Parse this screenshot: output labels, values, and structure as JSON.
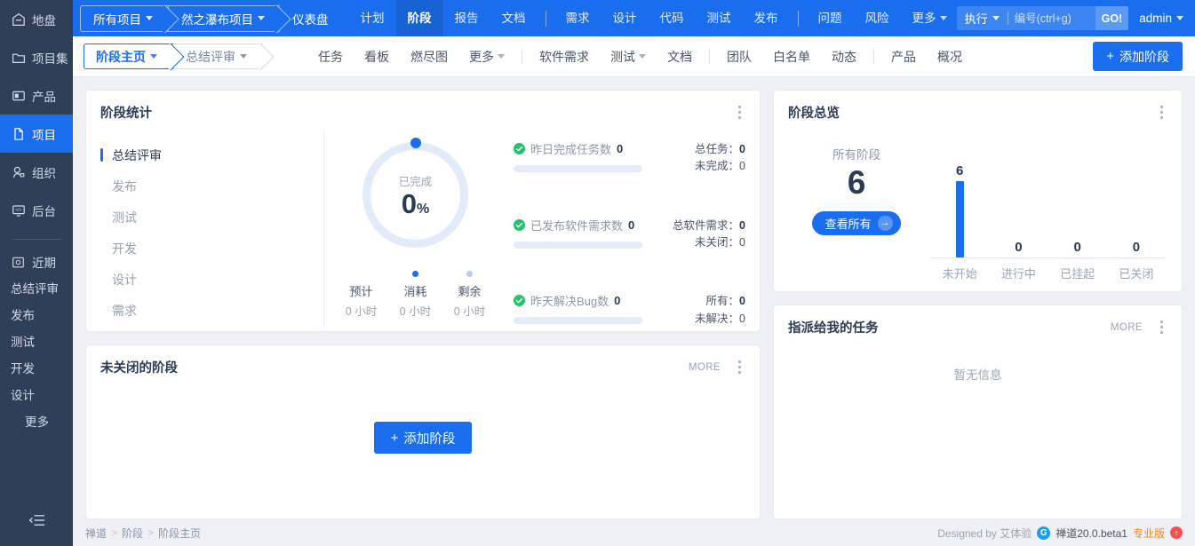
{
  "sidebar": {
    "items": [
      {
        "label": "地盘",
        "icon": "home-icon",
        "active": false
      },
      {
        "label": "项目集",
        "icon": "folder-icon",
        "active": false
      },
      {
        "label": "产品",
        "icon": "box-icon",
        "active": false
      },
      {
        "label": "项目",
        "icon": "file-icon",
        "active": true
      },
      {
        "label": "组织",
        "icon": "user-icon",
        "active": false
      },
      {
        "label": "后台",
        "icon": "monitor-icon",
        "active": false
      }
    ],
    "recent": {
      "label": "近期",
      "icon": "recent-icon"
    },
    "recent_items": [
      "总结评审",
      "发布",
      "测试",
      "开发",
      "设计"
    ],
    "more_label": "更多",
    "collapse_icon": "collapse-icon"
  },
  "topnav": {
    "breadcrumbs": [
      {
        "label": "所有项目",
        "dropdown": true
      },
      {
        "label": "然之瀑布项目",
        "dropdown": true
      },
      {
        "label": "仪表盘",
        "dropdown": false
      }
    ],
    "items_left": [
      {
        "label": "计划",
        "active": false
      },
      {
        "label": "阶段",
        "active": true
      },
      {
        "label": "报告",
        "active": false
      },
      {
        "label": "文档",
        "active": false
      }
    ],
    "items_mid": [
      {
        "label": "需求",
        "active": false
      },
      {
        "label": "设计",
        "active": false
      },
      {
        "label": "代码",
        "active": false
      },
      {
        "label": "测试",
        "active": false
      },
      {
        "label": "发布",
        "active": false
      }
    ],
    "items_right": [
      {
        "label": "问题",
        "active": false
      },
      {
        "label": "风险",
        "active": false
      },
      {
        "label": "更多",
        "active": false,
        "dropdown": true
      }
    ],
    "search": {
      "scope_label": "执行",
      "placeholder": "编号(ctrl+g)",
      "value": "",
      "go_label": "GO!"
    },
    "user": {
      "name": "admin"
    },
    "accent_color": "#1a6eee"
  },
  "subnav": {
    "breadcrumbs": [
      {
        "label": "阶段主页",
        "current": true,
        "dropdown": true
      },
      {
        "label": "总结评审",
        "current": false,
        "dropdown": true
      }
    ],
    "group1": [
      {
        "label": "任务",
        "dropdown": false
      },
      {
        "label": "看板",
        "dropdown": false
      },
      {
        "label": "燃尽图",
        "dropdown": false
      },
      {
        "label": "更多",
        "dropdown": true
      }
    ],
    "group2": [
      {
        "label": "软件需求",
        "dropdown": false
      },
      {
        "label": "测试",
        "dropdown": true
      },
      {
        "label": "文档",
        "dropdown": false
      }
    ],
    "group3": [
      {
        "label": "团队",
        "dropdown": false
      },
      {
        "label": "白名单",
        "dropdown": false
      },
      {
        "label": "动态",
        "dropdown": false
      }
    ],
    "group4": [
      {
        "label": "产品",
        "dropdown": false
      },
      {
        "label": "概况",
        "dropdown": false
      }
    ],
    "add_stage_label": "添加阶段"
  },
  "stage_stats": {
    "title": "阶段统计",
    "stages": [
      {
        "label": "总结评审",
        "selected": true
      },
      {
        "label": "发布",
        "selected": false
      },
      {
        "label": "测试",
        "selected": false
      },
      {
        "label": "开发",
        "selected": false
      },
      {
        "label": "设计",
        "selected": false
      },
      {
        "label": "需求",
        "selected": false
      }
    ],
    "donut": {
      "label": "已完成",
      "value": "0",
      "unit": "%",
      "percent": 0
    },
    "hours": [
      {
        "name": "预计",
        "value": "0 小时",
        "dot": "none"
      },
      {
        "name": "消耗",
        "value": "0 小时",
        "dot": "#1a6eee"
      },
      {
        "name": "剩余",
        "value": "0 小时",
        "dot": "#b5cdf5"
      }
    ],
    "kpis": [
      {
        "label": "昨日完成任务数",
        "count": "0",
        "progress": 0,
        "right": [
          {
            "name": "总任务",
            "value": "0"
          },
          {
            "name": "未完成",
            "value": "0"
          }
        ]
      },
      {
        "label": "已发布软件需求数",
        "count": "0",
        "progress": 0,
        "right": [
          {
            "name": "总软件需求",
            "value": "0"
          },
          {
            "name": "未关闭",
            "value": "0"
          }
        ]
      },
      {
        "label": "昨天解决Bug数",
        "count": "0",
        "progress": 0,
        "right": [
          {
            "name": "所有",
            "value": "0"
          },
          {
            "name": "未解决",
            "value": "0"
          }
        ]
      }
    ]
  },
  "unclosed": {
    "title": "未关闭的阶段",
    "more_label": "MORE",
    "add_button": "添加阶段"
  },
  "overview": {
    "title": "阶段总览",
    "all_label": "所有阶段",
    "all_value": "6",
    "view_all_label": "查看所有"
  },
  "assigned": {
    "title": "指派给我的任务",
    "more_label": "MORE",
    "empty_text": "暂无信息"
  },
  "footer": {
    "breadcrumb": [
      "禅道",
      "阶段",
      "阶段主页"
    ],
    "designed_by": "Designed by 艾体验",
    "version": "禅道20.0.beta1",
    "edition": "专业版"
  },
  "chart_data": {
    "type": "bar",
    "title": "阶段总览",
    "categories": [
      "未开始",
      "进行中",
      "已挂起",
      "已关闭"
    ],
    "values": [
      6,
      0,
      0,
      0
    ],
    "total": 6,
    "total_label": "所有阶段",
    "xlabel": "",
    "ylabel": "",
    "ylim": [
      0,
      6
    ],
    "grid": false,
    "legend": "none",
    "bar_color": "#1a6eee"
  }
}
